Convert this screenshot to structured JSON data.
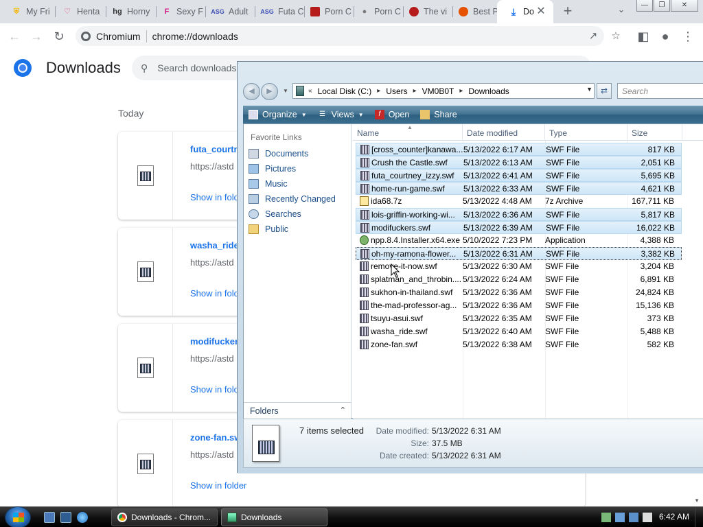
{
  "browser": {
    "tabs": [
      {
        "label": "My Fri",
        "icon": "brave-shield-icon",
        "color": "#f7b500"
      },
      {
        "label": "Henta",
        "icon": "heart-icon",
        "color": "#e91e63"
      },
      {
        "label": "Horny",
        "icon": "hg-logo-icon",
        "color": "#333333"
      },
      {
        "label": "Sexy F",
        "icon": "f-logo-icon",
        "color": "#d81b87"
      },
      {
        "label": "Adult",
        "icon": "asg-logo-icon",
        "color": "#3f51b5"
      },
      {
        "label": "Futa C",
        "icon": "asg-logo-icon",
        "color": "#3f51b5"
      },
      {
        "label": "Porn C",
        "icon": "porn-site-icon",
        "color": "#b71c1c"
      },
      {
        "label": "Porn C",
        "icon": "gamepad-icon",
        "color": "#777777"
      },
      {
        "label": "The vi",
        "icon": "shield-logo-icon",
        "color": "#b71c1c"
      },
      {
        "label": "Best P",
        "icon": "emoji-face-icon",
        "color": "#e65100"
      },
      {
        "label": "Do",
        "icon": "download-icon",
        "color": "#1a73e8"
      }
    ],
    "site_label": "Chromium",
    "url": "chrome://downloads"
  },
  "downloads": {
    "title": "Downloads",
    "search_placeholder": "Search downloads",
    "today_label": "Today",
    "items": [
      {
        "name": "futa_courtn",
        "url": "https://astd",
        "action": "Show in folder"
      },
      {
        "name": "washa_ride.",
        "url": "https://astd",
        "action": "Show in folder"
      },
      {
        "name": "modifuckers",
        "url": "https://astd",
        "action": "Show in folder"
      },
      {
        "name": "zone-fan.sw",
        "url": "https://astd",
        "action": "Show in folder"
      }
    ]
  },
  "explorer": {
    "breadcrumbs": [
      "Local Disk (C:)",
      "Users",
      "VM0B0T",
      "Downloads"
    ],
    "search_placeholder": "Search",
    "commands": [
      "Organize",
      "Views",
      "Open",
      "Share"
    ],
    "favorite_links_title": "Favorite Links",
    "favorite_links": [
      "Documents",
      "Pictures",
      "Music",
      "Recently Changed",
      "Searches",
      "Public"
    ],
    "folders_label": "Folders",
    "columns": [
      "Name",
      "Date modified",
      "Type",
      "Size"
    ],
    "files": [
      {
        "name": "[cross_counter]kanawa...",
        "date": "5/13/2022 6:17 AM",
        "type": "SWF File",
        "size": "817 KB",
        "selected": true,
        "kind": "swf"
      },
      {
        "name": "Crush the Castle.swf",
        "date": "5/13/2022 6:13 AM",
        "type": "SWF File",
        "size": "2,051 KB",
        "selected": true,
        "kind": "swf"
      },
      {
        "name": "futa_courtney_izzy.swf",
        "date": "5/13/2022 6:41 AM",
        "type": "SWF File",
        "size": "5,695 KB",
        "selected": true,
        "kind": "swf"
      },
      {
        "name": "home-run-game.swf",
        "date": "5/13/2022 6:33 AM",
        "type": "SWF File",
        "size": "4,621 KB",
        "selected": true,
        "kind": "swf"
      },
      {
        "name": "ida68.7z",
        "date": "5/13/2022 4:48 AM",
        "type": "7z Archive",
        "size": "167,711 KB",
        "selected": false,
        "kind": "zip"
      },
      {
        "name": "lois-griffin-working-wi...",
        "date": "5/13/2022 6:36 AM",
        "type": "SWF File",
        "size": "5,817 KB",
        "selected": true,
        "kind": "swf"
      },
      {
        "name": "modifuckers.swf",
        "date": "5/13/2022 6:39 AM",
        "type": "SWF File",
        "size": "16,022 KB",
        "selected": true,
        "kind": "swf"
      },
      {
        "name": "npp.8.4.Installer.x64.exe",
        "date": "5/10/2022 7:23 PM",
        "type": "Application",
        "size": "4,388 KB",
        "selected": false,
        "kind": "app"
      },
      {
        "name": "oh-my-ramona-flower...",
        "date": "5/13/2022 6:31 AM",
        "type": "SWF File",
        "size": "3,382 KB",
        "selected": true,
        "kind": "swf"
      },
      {
        "name": "remove-it-now.swf",
        "date": "5/13/2022 6:30 AM",
        "type": "SWF File",
        "size": "3,204 KB",
        "selected": false,
        "kind": "swf"
      },
      {
        "name": "splatman_and_throbin....",
        "date": "5/13/2022 6:24 AM",
        "type": "SWF File",
        "size": "6,891 KB",
        "selected": false,
        "kind": "swf"
      },
      {
        "name": "sukhon-in-thailand.swf",
        "date": "5/13/2022 6:36 AM",
        "type": "SWF File",
        "size": "24,824 KB",
        "selected": false,
        "kind": "swf"
      },
      {
        "name": "the-mad-professor-ag...",
        "date": "5/13/2022 6:36 AM",
        "type": "SWF File",
        "size": "15,136 KB",
        "selected": false,
        "kind": "swf"
      },
      {
        "name": "tsuyu-asui.swf",
        "date": "5/13/2022 6:35 AM",
        "type": "SWF File",
        "size": "373 KB",
        "selected": false,
        "kind": "swf"
      },
      {
        "name": "washa_ride.swf",
        "date": "5/13/2022 6:40 AM",
        "type": "SWF File",
        "size": "5,488 KB",
        "selected": false,
        "kind": "swf"
      },
      {
        "name": "zone-fan.swf",
        "date": "5/13/2022 6:38 AM",
        "type": "SWF File",
        "size": "582 KB",
        "selected": false,
        "kind": "swf"
      }
    ],
    "details": {
      "selection": "7 items selected",
      "date_modified_label": "Date modified:",
      "date_modified": "5/13/2022 6:31 AM",
      "size_label": "Size:",
      "size": "37.5 MB",
      "date_created_label": "Date created:",
      "date_created": "5/13/2022 6:31 AM"
    }
  },
  "taskbar": {
    "buttons": [
      "Downloads - Chrom...",
      "Downloads"
    ],
    "clock": "6:42 AM"
  }
}
